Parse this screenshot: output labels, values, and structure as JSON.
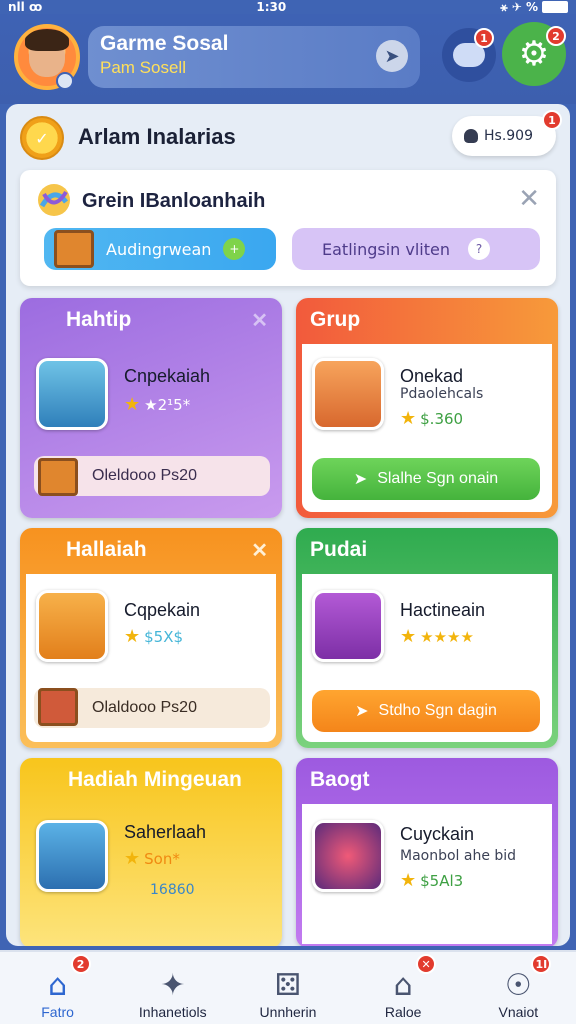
{
  "status_bar": {
    "carrier": "nll ꝏ",
    "time": "1:30",
    "icons": "⚹ ✈ %"
  },
  "header": {
    "title": "Garme Sosal",
    "subtitle": "Pam Sosell",
    "chat_badge": "1",
    "settings_badge": "2"
  },
  "user_row": {
    "name": "Arlam Inalarias",
    "score": "Hs.909",
    "score_badge": "1"
  },
  "banner": {
    "title": "Grein IBanloanhaih",
    "btn_blue_label": "Audingrwean",
    "btn_purple_label": "Eatlingsin vliten"
  },
  "cards": [
    {
      "title": "Hahtip",
      "name": "Cnpekaiah",
      "stars_text": "★2¹5*",
      "footer": "Oleldooo Ps20",
      "colors": {
        "header": "#9b6bdb"
      }
    },
    {
      "title": "Grup",
      "name": "Onekad",
      "sub": "Pdaolehcals",
      "stars_text": "$.360",
      "button": "Slalhe Sgn onain",
      "colors": {
        "header": "#f2643a"
      }
    },
    {
      "title": "Hallaiah",
      "name": "Cqpekain",
      "stars_text": "$5X$",
      "footer": "Olaldooo Ps20",
      "colors": {
        "header": "#f58c1c"
      }
    },
    {
      "title": "Pudai",
      "name": "Hactineain",
      "stars_text": "★★★★",
      "button": "Stdho Sgn dagin",
      "colors": {
        "header": "#32b052"
      }
    },
    {
      "title": "Hadiah Mingeuan",
      "name": "Saherlaah",
      "stars_text": "Son*",
      "sub": "16860",
      "colors": {
        "header": "#f7c21b"
      }
    },
    {
      "title": "Baogt",
      "name": "Cuyckain",
      "sub": "Maonbol ahe bid",
      "stars_text": "$5Al3",
      "colors": {
        "header": "#a660e0"
      }
    }
  ],
  "bottom_nav": [
    {
      "label": "Fatro",
      "badge": "2",
      "icon": "home-icon"
    },
    {
      "label": "Inhanetiols",
      "icon": "rocket-icon"
    },
    {
      "label": "Unnherin",
      "icon": "dice-icon"
    },
    {
      "label": "Raloe",
      "badge": "✕",
      "icon": "house-icon"
    },
    {
      "label": "Vnaiot",
      "badge": "1I",
      "icon": "lock-icon"
    }
  ]
}
